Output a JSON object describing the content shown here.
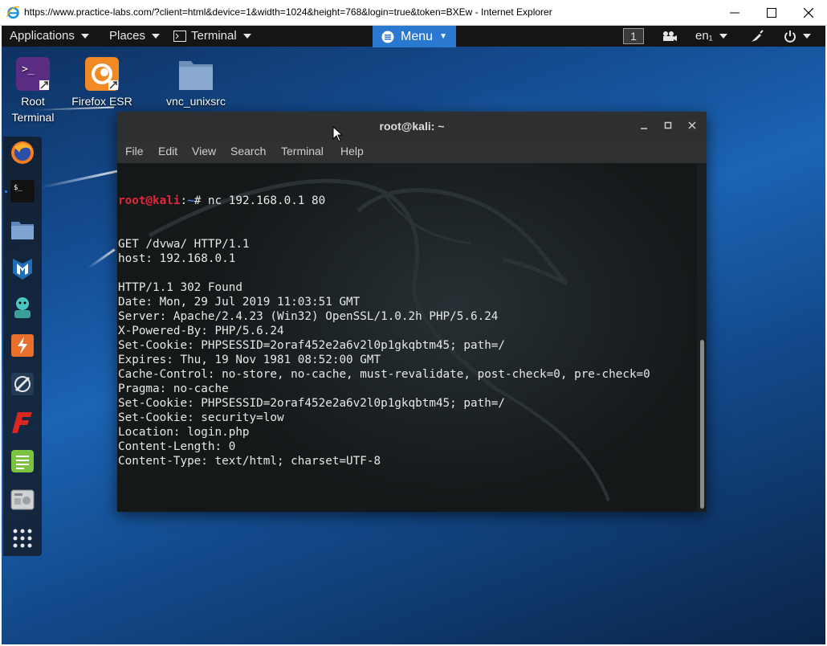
{
  "browser": {
    "title": "https://www.practice-labs.com/?client=html&device=1&width=1024&height=768&login=true&token=BXEw - Internet Explorer"
  },
  "panel": {
    "applications": "Applications",
    "places": "Places",
    "terminal": "Terminal",
    "menu": "Menu",
    "workspace": "1",
    "language": "en₁"
  },
  "desktop_icons": [
    {
      "label_line1": "Root",
      "label_line2": "Terminal"
    },
    {
      "label": "Firefox ESR"
    },
    {
      "label": "vnc_unixsrc"
    }
  ],
  "terminal": {
    "title": "root@kali: ~",
    "menu": [
      "File",
      "Edit",
      "View",
      "Search",
      "Terminal",
      "Help"
    ],
    "prompt_user": "root@kali",
    "prompt_sep": ":",
    "prompt_path": "~",
    "prompt_symbol": "# ",
    "command": "nc 192.168.0.1 80",
    "output": [
      "GET /dvwa/ HTTP/1.1",
      "host: 192.168.0.1",
      "",
      "HTTP/1.1 302 Found",
      "Date: Mon, 29 Jul 2019 11:03:51 GMT",
      "Server: Apache/2.4.23 (Win32) OpenSSL/1.0.2h PHP/5.6.24",
      "X-Powered-By: PHP/5.6.24",
      "Set-Cookie: PHPSESSID=2oraf452e2a6v2l0p1gkqbtm45; path=/",
      "Expires: Thu, 19 Nov 1981 08:52:00 GMT",
      "Cache-Control: no-store, no-cache, must-revalidate, post-check=0, pre-check=0",
      "Pragma: no-cache",
      "Set-Cookie: PHPSESSID=2oraf452e2a6v2l0p1gkqbtm45; path=/",
      "Set-Cookie: security=low",
      "Location: login.php",
      "Content-Length: 0",
      "Content-Type: text/html; charset=UTF-8",
      ""
    ]
  },
  "colors": {
    "prompt_user": "#e0283a",
    "prompt_path": "#3d83e6",
    "menu_button": "#2a78d0"
  }
}
